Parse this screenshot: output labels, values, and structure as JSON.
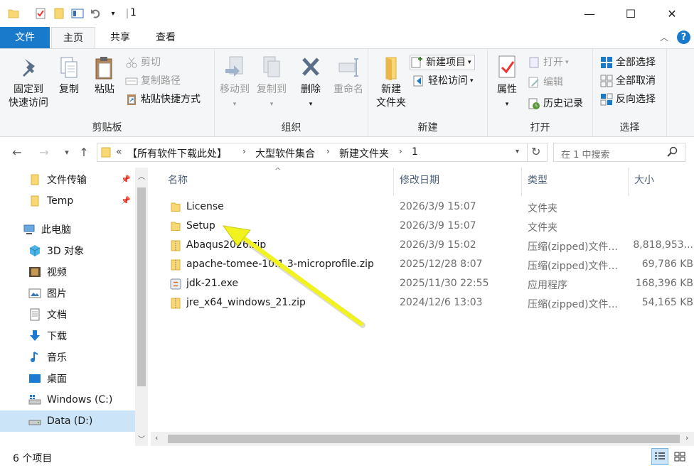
{
  "window": {
    "title": "1",
    "minimize_glyph": "—",
    "maximize_glyph": "☐",
    "close_glyph": "✕"
  },
  "tabs": {
    "file": "文件",
    "home": "主页",
    "share": "共享",
    "view": "查看"
  },
  "ribbon": {
    "clipboard": {
      "label": "剪贴板",
      "pin": "固定到\n快速访问",
      "pin_l1": "固定到",
      "pin_l2": "快速访问",
      "copy": "复制",
      "paste": "粘贴",
      "cut": "剪切",
      "copy_path": "复制路径",
      "paste_shortcut": "粘贴快捷方式"
    },
    "organize": {
      "label": "组织",
      "move_to": "移动到",
      "copy_to": "复制到",
      "delete": "删除",
      "rename": "重命名"
    },
    "new": {
      "label": "新建",
      "new_folder_l1": "新建",
      "new_folder_l2": "文件夹",
      "new_item": "新建项目",
      "easy_access": "轻松访问"
    },
    "open": {
      "label": "打开",
      "properties": "属性",
      "open": "打开",
      "edit": "编辑",
      "history": "历史记录"
    },
    "select": {
      "label": "选择",
      "select_all": "全部选择",
      "select_none": "全部取消",
      "invert": "反向选择"
    }
  },
  "address": {
    "prefix": "«",
    "crumbs": [
      "【所有软件下载此处】",
      "大型软件集合",
      "新建文件夹",
      "1"
    ],
    "search_placeholder": "在 1 中搜索"
  },
  "nav": {
    "items": [
      {
        "label": "文件传输",
        "pinned": true
      },
      {
        "label": "Temp",
        "pinned": true
      },
      {
        "label": "此电脑"
      },
      {
        "label": "3D 对象"
      },
      {
        "label": "视频"
      },
      {
        "label": "图片"
      },
      {
        "label": "文档"
      },
      {
        "label": "下载"
      },
      {
        "label": "音乐"
      },
      {
        "label": "桌面"
      },
      {
        "label": "Windows (C:)"
      },
      {
        "label": "Data (D:)",
        "selected": true
      }
    ]
  },
  "columns": {
    "name": "名称",
    "date": "修改日期",
    "type": "类型",
    "size": "大小"
  },
  "files": [
    {
      "name": "License",
      "date": "2026/3/9 15:07",
      "type": "文件夹",
      "size": "",
      "icon": "folder-icon"
    },
    {
      "name": "Setup",
      "date": "2026/3/9 15:07",
      "type": "文件夹",
      "size": "",
      "icon": "folder-icon"
    },
    {
      "name": "Abaqus2026.zip",
      "date": "2026/3/9 15:02",
      "type": "压缩(zipped)文件...",
      "size": "8,818,953...",
      "icon": "zip-icon"
    },
    {
      "name": "apache-tomee-10.1.3-microprofile.zip",
      "date": "2025/12/28 8:07",
      "type": "压缩(zipped)文件...",
      "size": "69,786 KB",
      "icon": "zip-icon"
    },
    {
      "name": "jdk-21.exe",
      "date": "2025/11/30 22:55",
      "type": "应用程序",
      "size": "168,396 KB",
      "icon": "exe-icon"
    },
    {
      "name": "jre_x64_windows_21.zip",
      "date": "2024/12/6 13:03",
      "type": "压缩(zipped)文件...",
      "size": "54,165 KB",
      "icon": "zip-icon"
    }
  ],
  "status": {
    "count": "6 个项目"
  },
  "colors": {
    "accent": "#1979ca",
    "folder": "#f8d775",
    "selected": "#cce4f7",
    "annotation_arrow": "#f2f21e"
  }
}
